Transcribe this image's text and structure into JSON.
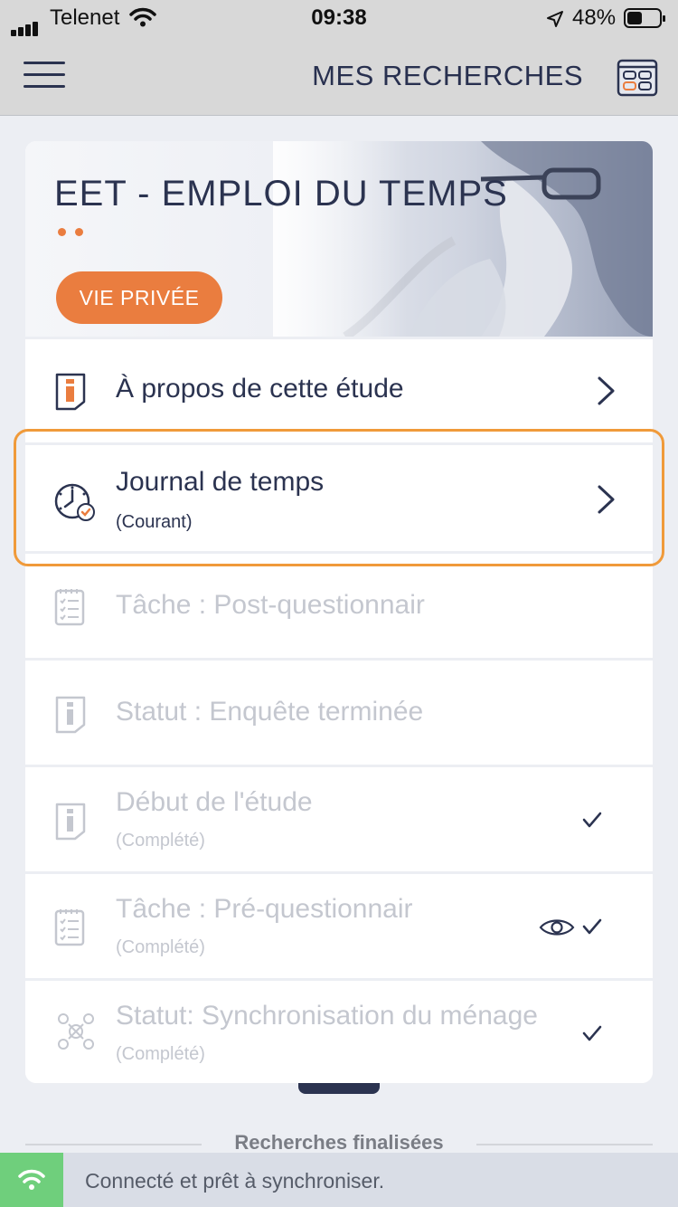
{
  "status_bar": {
    "carrier": "Telenet",
    "time": "09:38",
    "battery_pct": "48%",
    "battery_level": 0.48
  },
  "nav": {
    "title": "MES RECHERCHES",
    "menu_icon": "hamburger-icon",
    "calendar_icon": "calendar-icon"
  },
  "study": {
    "title": "EET - EMPLOI DU TEMPS",
    "privacy_button": "VIE PRIVÉE",
    "items": [
      {
        "label": "À propos de cette étude",
        "sub": "",
        "icon": "info-document-icon",
        "enabled": true,
        "chevron": true
      },
      {
        "label": "Journal de temps",
        "sub": "(Courant)",
        "icon": "clock-check-icon",
        "enabled": true,
        "chevron": true,
        "current": true
      },
      {
        "label": "Tâche : Post-questionnair",
        "sub": "",
        "icon": "checklist-icon",
        "enabled": false
      },
      {
        "label": "Statut : Enquête terminée",
        "sub": "",
        "icon": "info-document-icon",
        "enabled": false
      },
      {
        "label": "Début de l'étude",
        "sub": "(Complété)",
        "icon": "info-document-icon",
        "enabled": false,
        "check": true
      },
      {
        "label": "Tâche : Pré-questionnair",
        "sub": "(Complété)",
        "icon": "checklist-icon",
        "enabled": false,
        "check": true,
        "eye": true
      },
      {
        "label": "Statut: Synchronisation du ménage",
        "sub": "(Complété)",
        "icon": "people-sync-icon",
        "enabled": false,
        "check": true
      }
    ]
  },
  "section": {
    "finished_label": "Recherches finalisées"
  },
  "sync": {
    "message": "Connecté et prêt à synchroniser."
  },
  "colors": {
    "accent": "#ea7d3f",
    "highlight": "#f09a3a",
    "navy": "#2b3350",
    "sync_ok": "#6fcf7c"
  }
}
